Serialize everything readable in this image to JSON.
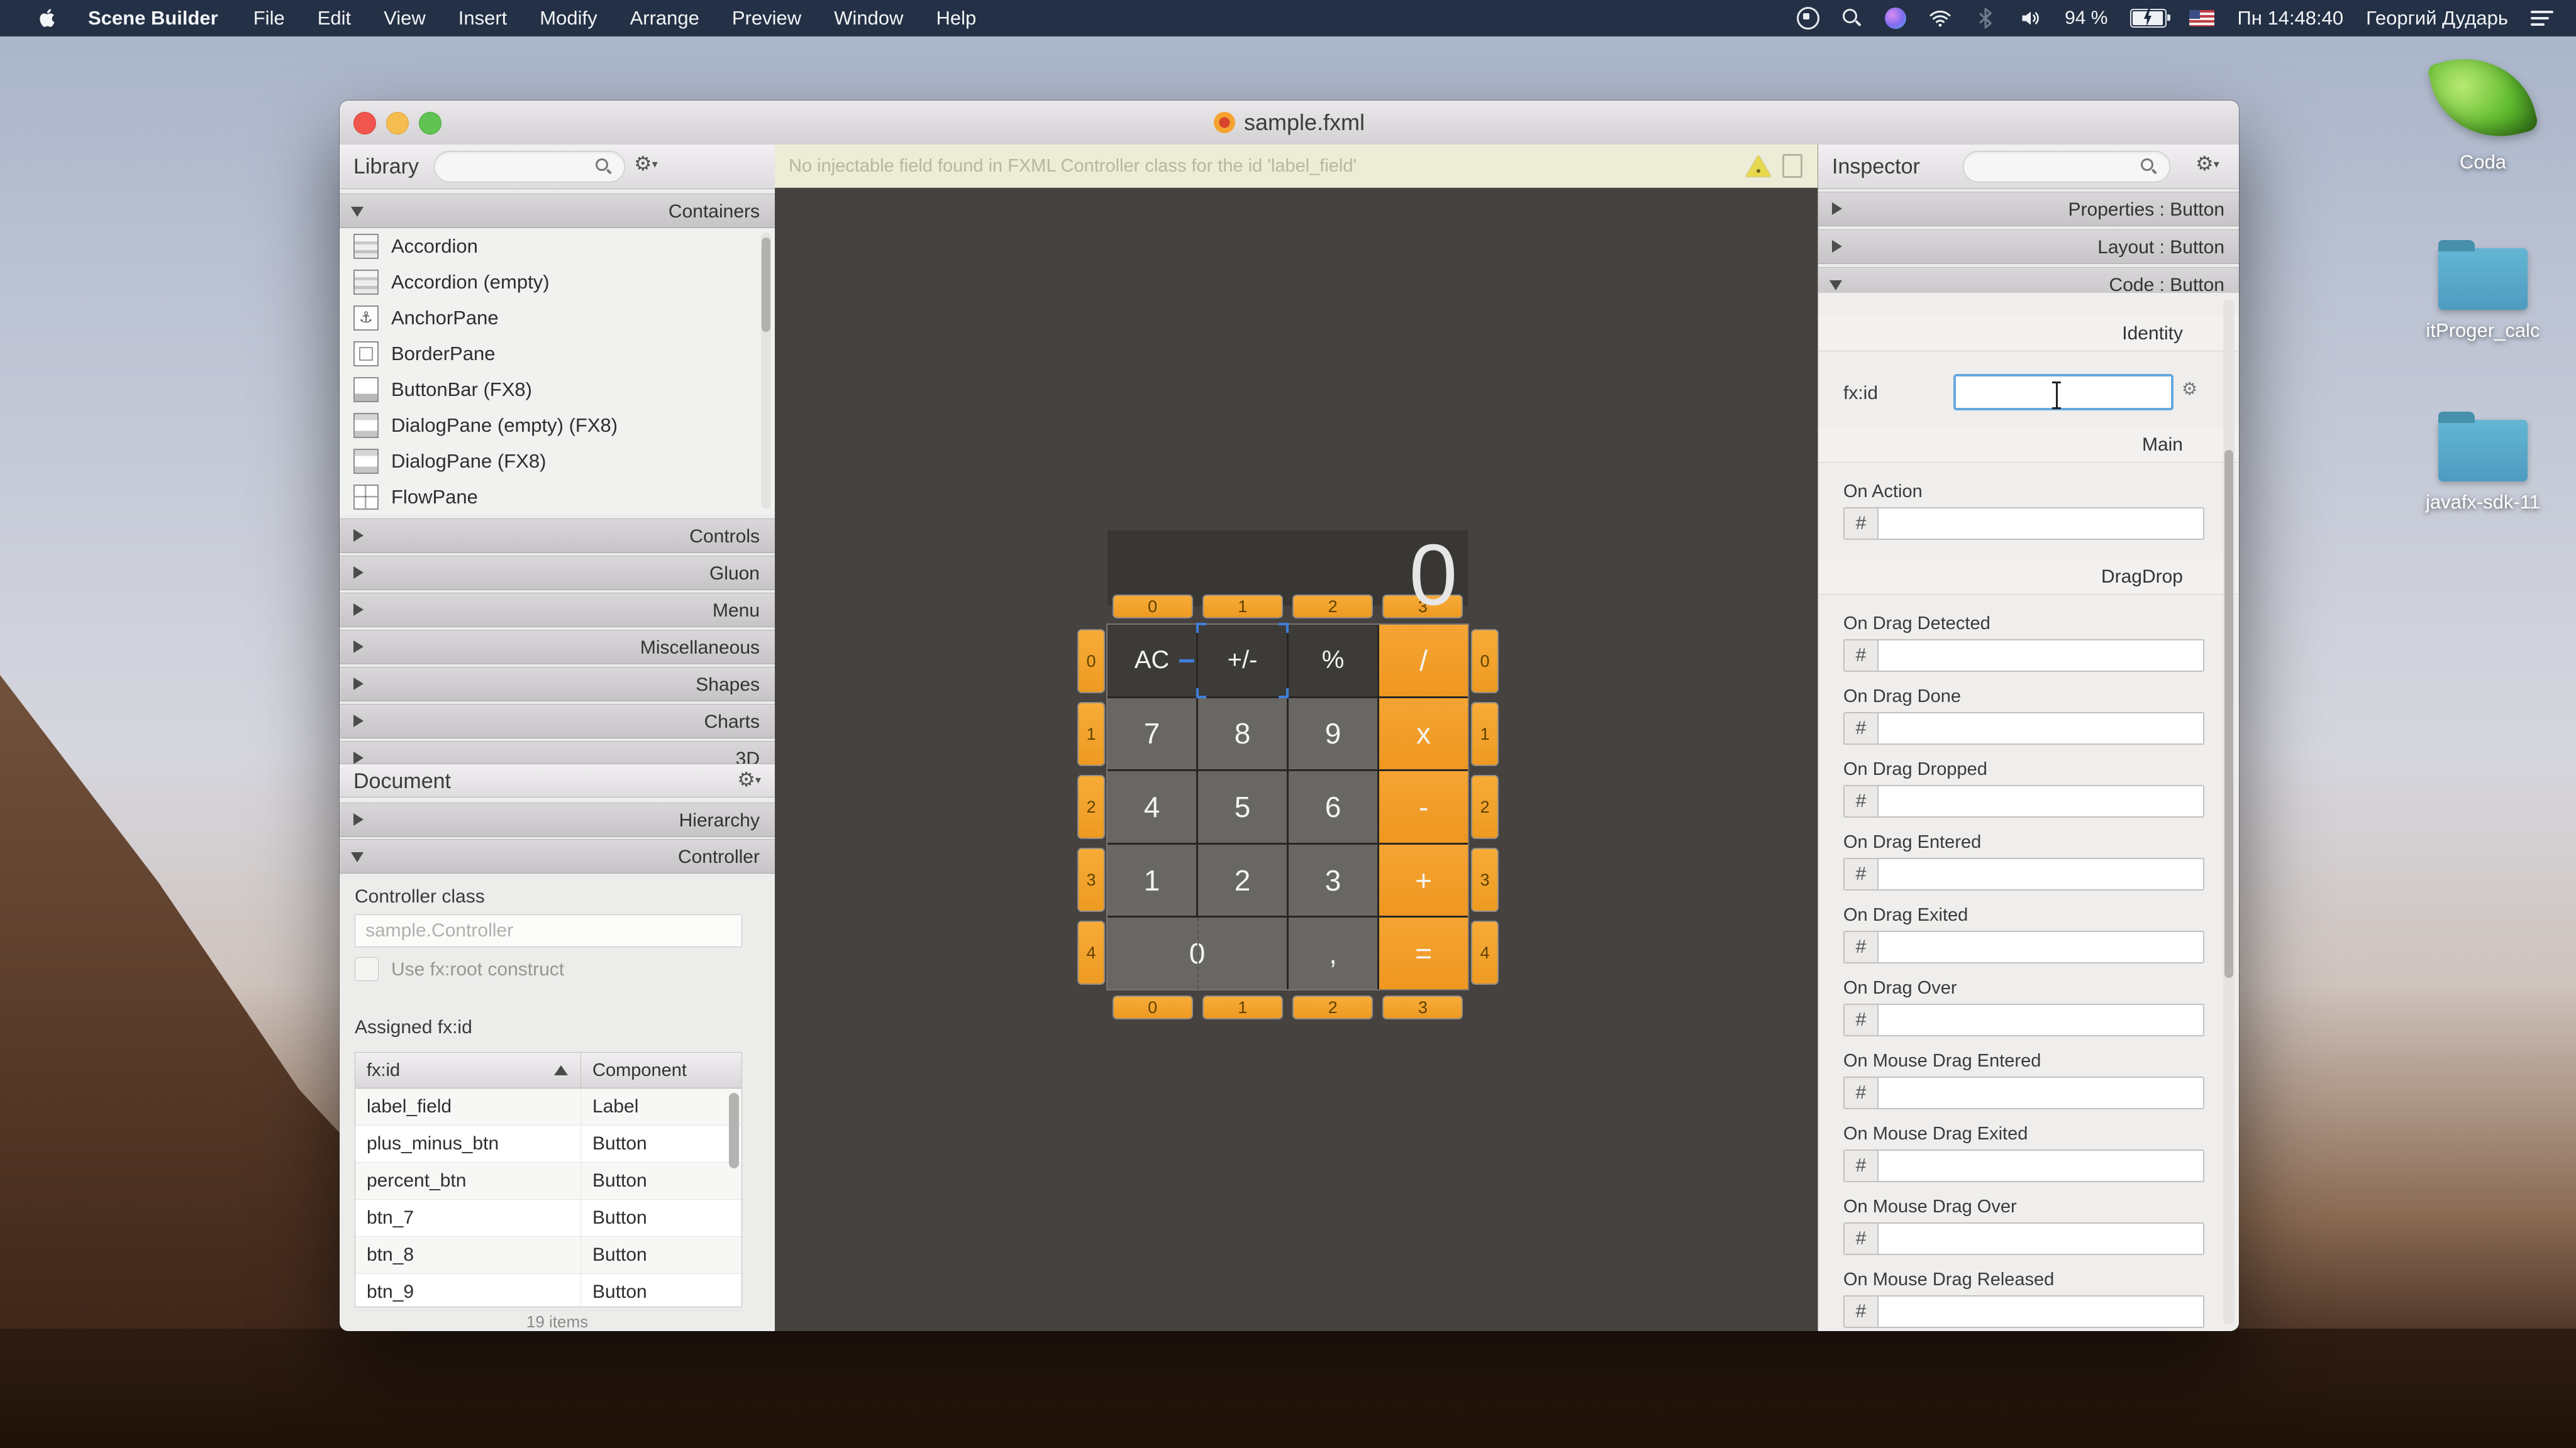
{
  "colors": {
    "accent_orange": "#f2a02c",
    "selection_blue": "#3f7fd9",
    "canvas_bg": "#45423f",
    "menu_bar_bg": "#18253a"
  },
  "menu_bar": {
    "app_name": "Scene Builder",
    "items": [
      "File",
      "Edit",
      "View",
      "Insert",
      "Modify",
      "Arrange",
      "Preview",
      "Window",
      "Help"
    ],
    "status": {
      "battery_pct": "94 %",
      "time": "Пн 14:48:40",
      "user": "Георгий Дударь"
    }
  },
  "window": {
    "title": "sample.fxml",
    "notification": "No injectable field found in FXML Controller class for the id 'label_field'"
  },
  "library": {
    "title": "Library",
    "search_placeholder": "",
    "containers_header": "Containers",
    "container_items": [
      {
        "label": "Accordion",
        "icon": "accordion"
      },
      {
        "label": "Accordion (empty)",
        "icon": "accordion"
      },
      {
        "label": "AnchorPane",
        "icon": "anchorpane"
      },
      {
        "label": "BorderPane",
        "icon": "borderpane"
      },
      {
        "label": "ButtonBar (FX8)",
        "icon": "buttonbar"
      },
      {
        "label": "DialogPane (empty) (FX8)",
        "icon": "dialogpane"
      },
      {
        "label": "DialogPane (FX8)",
        "icon": "dialogpane"
      },
      {
        "label": "FlowPane",
        "icon": "flowpane"
      }
    ],
    "collapsed_sections": [
      "Controls",
      "Gluon",
      "Menu",
      "Miscellaneous",
      "Shapes",
      "Charts",
      "3D"
    ]
  },
  "document": {
    "title": "Document",
    "hierarchy_label": "Hierarchy",
    "controller_label": "Controller",
    "controller_class_label": "Controller class",
    "controller_class_placeholder": "sample.Controller",
    "fxroot_label": "Use fx:root construct",
    "assigned_label": "Assigned fx:id",
    "table": {
      "col1": "fx:id",
      "col2": "Component",
      "rows": [
        [
          "label_field",
          "Label"
        ],
        [
          "plus_minus_btn",
          "Button"
        ],
        [
          "percent_btn",
          "Button"
        ],
        [
          "btn_7",
          "Button"
        ],
        [
          "btn_8",
          "Button"
        ],
        [
          "btn_9",
          "Button"
        ]
      ],
      "footer": "19 items"
    }
  },
  "inspector": {
    "title": "Inspector",
    "search_placeholder": "",
    "sections": [
      "Properties : Button",
      "Layout : Button",
      "Code : Button"
    ],
    "code": {
      "identity_header": "Identity",
      "fxid_label": "fx:id",
      "main_header": "Main",
      "on_action_label": "On Action",
      "hash": "#",
      "dragdrop_header": "DragDrop",
      "event_fields": [
        "On Drag Detected",
        "On Drag Done",
        "On Drag Dropped",
        "On Drag Entered",
        "On Drag Exited",
        "On Drag Over",
        "On Mouse Drag Entered",
        "On Mouse Drag Exited",
        "On Mouse Drag Over",
        "On Mouse Drag Released"
      ]
    }
  },
  "canvas": {
    "calculator": {
      "display_value": "0",
      "col_headers": [
        "0",
        "1",
        "2",
        "3"
      ],
      "row_headers": [
        "0",
        "1",
        "2",
        "3",
        "4"
      ],
      "rows": [
        [
          {
            "label": "AC",
            "type": "dark"
          },
          {
            "label": "+/-",
            "type": "dark",
            "selected": true
          },
          {
            "label": "%",
            "type": "dark"
          },
          {
            "label": "/",
            "type": "op"
          }
        ],
        [
          {
            "label": "7",
            "type": "num"
          },
          {
            "label": "8",
            "type": "num"
          },
          {
            "label": "9",
            "type": "num"
          },
          {
            "label": "x",
            "type": "op"
          }
        ],
        [
          {
            "label": "4",
            "type": "num"
          },
          {
            "label": "5",
            "type": "num"
          },
          {
            "label": "6",
            "type": "num"
          },
          {
            "label": "-",
            "type": "op"
          }
        ],
        [
          {
            "label": "1",
            "type": "num"
          },
          {
            "label": "2",
            "type": "num"
          },
          {
            "label": "3",
            "type": "num"
          },
          {
            "label": "+",
            "type": "op"
          }
        ],
        [
          {
            "label": "0",
            "type": "num",
            "span": 2
          },
          {
            "label": ",",
            "type": "num"
          },
          {
            "label": "=",
            "type": "op"
          }
        ]
      ]
    }
  },
  "desktop": {
    "icons": [
      {
        "label": "Coda",
        "type": "leaf"
      },
      {
        "label": "itProger_calc",
        "type": "folder"
      },
      {
        "label": "javafx-sdk-11",
        "type": "folder"
      }
    ]
  }
}
